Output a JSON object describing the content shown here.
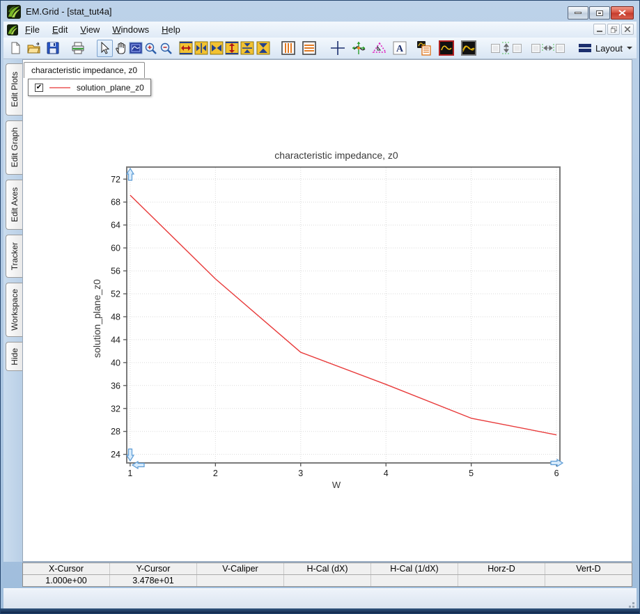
{
  "window": {
    "title": "EM.Grid - [stat_tut4a]"
  },
  "menu": {
    "items": [
      "File",
      "Edit",
      "View",
      "Windows",
      "Help"
    ]
  },
  "toolbar": {
    "layout_label": "Layout"
  },
  "sidebar": {
    "tabs": [
      "Edit Plots",
      "Edit Graph",
      "Edit Axes",
      "Tracker",
      "Workspace",
      "Hide"
    ]
  },
  "document": {
    "tab_label": "characteristic impedance, z0"
  },
  "legend": {
    "checked": true,
    "label": "solution_plane_z0",
    "sample_color": "#f08080",
    "check_glyph": "✔"
  },
  "chart_data": {
    "type": "line",
    "title": "characteristic impedance, z0",
    "xlabel": "W",
    "ylabel": "solution_plane_z0",
    "xlim": [
      0.96,
      6.04
    ],
    "ylim": [
      22.5,
      74.1
    ],
    "xticks": [
      1,
      2,
      3,
      4,
      5,
      6
    ],
    "yticks": [
      24,
      28,
      32,
      36,
      40,
      44,
      48,
      52,
      56,
      60,
      64,
      68,
      72
    ],
    "grid": true,
    "legend_position": "top-left-floating",
    "series": [
      {
        "name": "solution_plane_z0",
        "color": "#e83a3a",
        "x": [
          1,
          2,
          3,
          4,
          5,
          6
        ],
        "y": [
          69.2,
          54.6,
          41.8,
          36.2,
          30.3,
          27.4
        ]
      }
    ]
  },
  "status_table": {
    "columns": [
      "X-Cursor",
      "Y-Cursor",
      "V-Caliper",
      "H-Cal (dX)",
      "H-Cal (1/dX)",
      "Horz-D",
      "Vert-D"
    ],
    "values": [
      "1.000e+00",
      "3.478e+01",
      "",
      "",
      "",
      "",
      ""
    ]
  }
}
